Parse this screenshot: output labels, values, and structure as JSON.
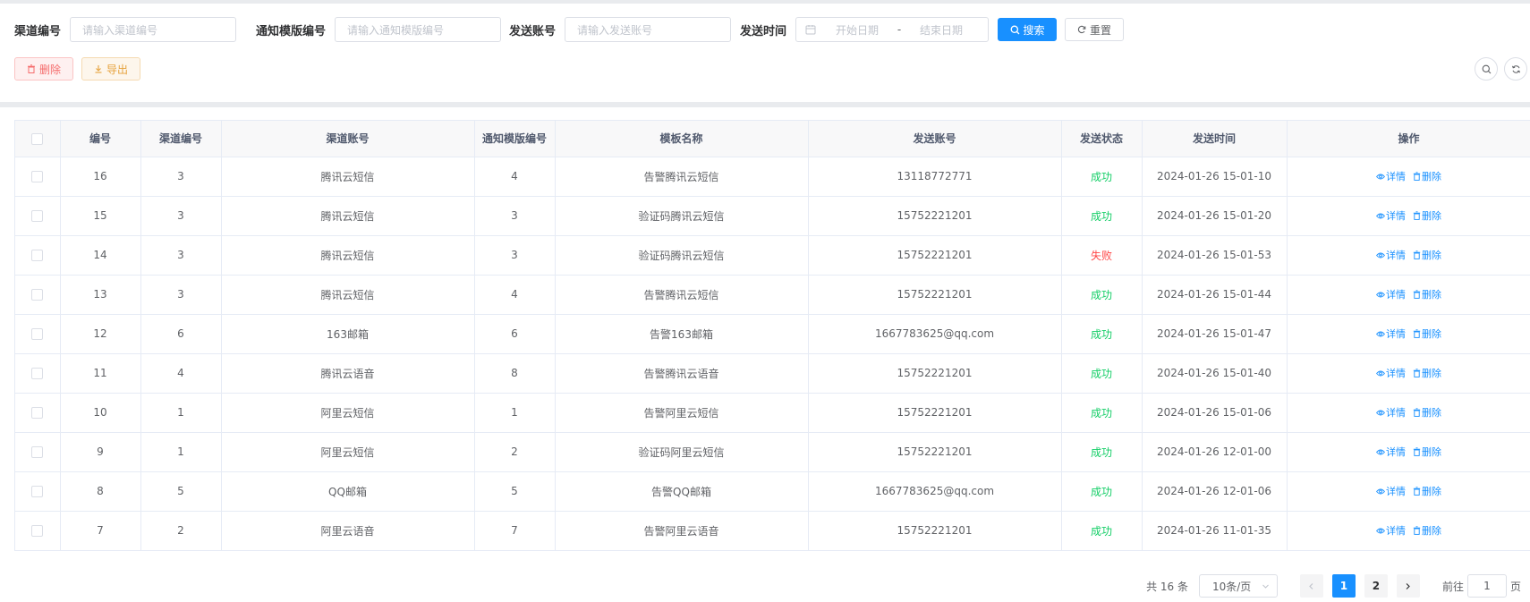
{
  "search": {
    "channel_no_label": "渠道编号",
    "channel_no_placeholder": "请输入渠道编号",
    "template_no_label": "通知模版编号",
    "template_no_placeholder": "请输入通知模版编号",
    "account_label": "发送账号",
    "account_placeholder": "请输入发送账号",
    "time_label": "发送时间",
    "start_placeholder": "开始日期",
    "range_sep": "-",
    "end_placeholder": "结束日期",
    "search_button": "搜索",
    "reset_button": "重置"
  },
  "toolbar": {
    "delete_button": "删除",
    "export_button": "导出"
  },
  "table": {
    "columns": [
      "编号",
      "渠道编号",
      "渠道账号",
      "通知模版编号",
      "模板名称",
      "发送账号",
      "发送状态",
      "发送时间",
      "操作"
    ],
    "detail_label": "详情",
    "delete_label": "删除",
    "rows": [
      {
        "id": "16",
        "channel_no": "3",
        "channel_account": "腾讯云短信",
        "template_no": "4",
        "template_name": "告警腾讯云短信",
        "account": "13118772771",
        "status": "成功",
        "status_type": "ok",
        "time": "2024-01-26 15-01-10"
      },
      {
        "id": "15",
        "channel_no": "3",
        "channel_account": "腾讯云短信",
        "template_no": "3",
        "template_name": "验证码腾讯云短信",
        "account": "15752221201",
        "status": "成功",
        "status_type": "ok",
        "time": "2024-01-26 15-01-20"
      },
      {
        "id": "14",
        "channel_no": "3",
        "channel_account": "腾讯云短信",
        "template_no": "3",
        "template_name": "验证码腾讯云短信",
        "account": "15752221201",
        "status": "失败",
        "status_type": "fail",
        "time": "2024-01-26 15-01-53"
      },
      {
        "id": "13",
        "channel_no": "3",
        "channel_account": "腾讯云短信",
        "template_no": "4",
        "template_name": "告警腾讯云短信",
        "account": "15752221201",
        "status": "成功",
        "status_type": "ok",
        "time": "2024-01-26 15-01-44"
      },
      {
        "id": "12",
        "channel_no": "6",
        "channel_account": "163邮箱",
        "template_no": "6",
        "template_name": "告警163邮箱",
        "account": "1667783625@qq.com",
        "status": "成功",
        "status_type": "ok",
        "time": "2024-01-26 15-01-47"
      },
      {
        "id": "11",
        "channel_no": "4",
        "channel_account": "腾讯云语音",
        "template_no": "8",
        "template_name": "告警腾讯云语音",
        "account": "15752221201",
        "status": "成功",
        "status_type": "ok",
        "time": "2024-01-26 15-01-40"
      },
      {
        "id": "10",
        "channel_no": "1",
        "channel_account": "阿里云短信",
        "template_no": "1",
        "template_name": "告警阿里云短信",
        "account": "15752221201",
        "status": "成功",
        "status_type": "ok",
        "time": "2024-01-26 15-01-06"
      },
      {
        "id": "9",
        "channel_no": "1",
        "channel_account": "阿里云短信",
        "template_no": "2",
        "template_name": "验证码阿里云短信",
        "account": "15752221201",
        "status": "成功",
        "status_type": "ok",
        "time": "2024-01-26 12-01-00"
      },
      {
        "id": "8",
        "channel_no": "5",
        "channel_account": "QQ邮箱",
        "template_no": "5",
        "template_name": "告警QQ邮箱",
        "account": "1667783625@qq.com",
        "status": "成功",
        "status_type": "ok",
        "time": "2024-01-26 12-01-06"
      },
      {
        "id": "7",
        "channel_no": "2",
        "channel_account": "阿里云语音",
        "template_no": "7",
        "template_name": "告警阿里云语音",
        "account": "15752221201",
        "status": "成功",
        "status_type": "ok",
        "time": "2024-01-26 11-01-35"
      }
    ]
  },
  "pagination": {
    "total": "共 16 条",
    "page_size": "10条/页",
    "pages": [
      "1",
      "2"
    ],
    "current_page": "1",
    "goto_prefix": "前往",
    "goto_value": "1",
    "goto_suffix": "页"
  },
  "colors": {
    "primary": "#1890ff",
    "success": "#13ce66",
    "danger": "#ff4949",
    "warning": "#e6a23c"
  },
  "icons": [
    "search-icon",
    "refresh-icon",
    "calendar-icon",
    "trash-icon",
    "download-icon",
    "eye-icon",
    "chevron-left-icon",
    "chevron-right-icon",
    "chevron-down-icon"
  ]
}
